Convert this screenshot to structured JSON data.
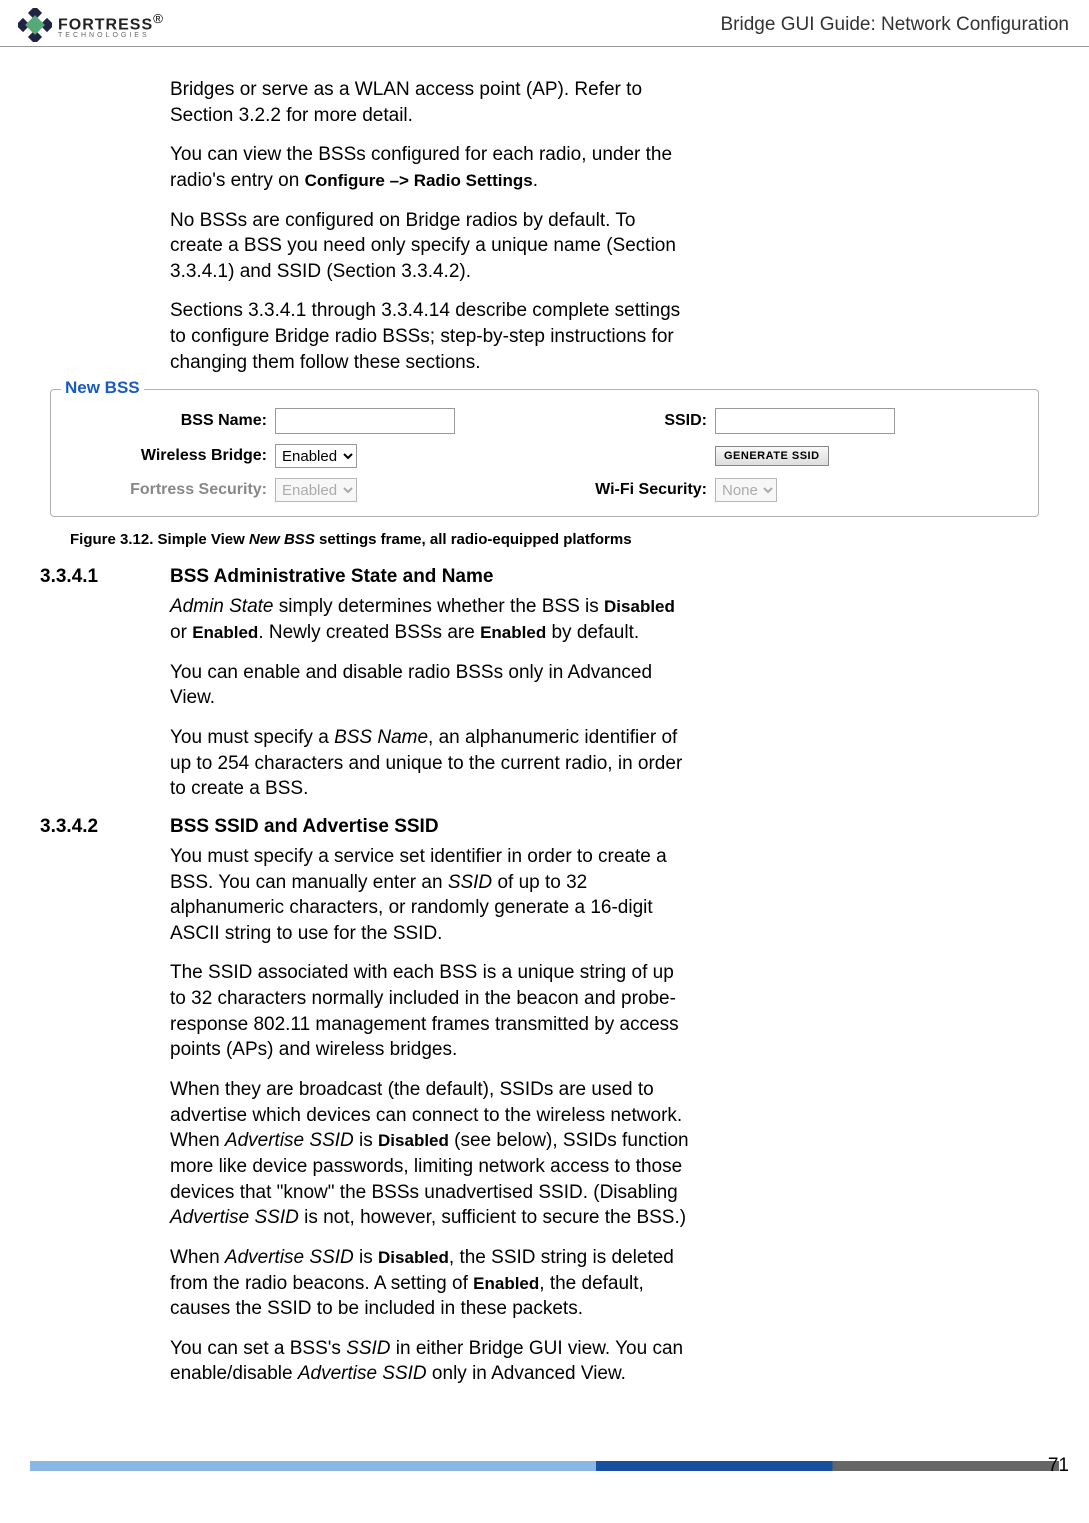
{
  "header": {
    "logo_main": "FORTRESS",
    "logo_reg": "®",
    "logo_sub": "TECHNOLOGIES",
    "title": "Bridge GUI Guide: Network Configuration"
  },
  "intro": {
    "p1": "Bridges or serve as a WLAN access point (AP). Refer to Section 3.2.2 for more detail.",
    "p2a": "You can view the BSSs configured for each radio, under the radio's entry on ",
    "p2b": "Configure  –> Radio Settings",
    "p2c": ".",
    "p3": "No BSSs are configured on Bridge radios by default. To create a BSS you need only specify a unique name (Section 3.3.4.1) and SSID (Section 3.3.4.2).",
    "p4": "Sections 3.3.4.1 through 3.3.4.14 describe complete settings to configure Bridge radio BSSs; step-by-step instructions for changing them follow these sections."
  },
  "form": {
    "legend": "New BSS",
    "labels": {
      "bss_name": "BSS Name:",
      "ssid": "SSID:",
      "wireless_bridge": "Wireless Bridge:",
      "fortress_security": "Fortress Security:",
      "wifi_security": "Wi-Fi Security:"
    },
    "values": {
      "wireless_bridge": "Enabled",
      "fortress_security": "Enabled",
      "wifi_security": "None"
    },
    "generate_btn": "GENERATE SSID"
  },
  "figure_caption": {
    "prefix": "Figure 3.12. Simple View ",
    "italic": "New BSS",
    "suffix": " settings frame, all radio-equipped platforms"
  },
  "sections": {
    "s1": {
      "num": "3.3.4.1",
      "title": "BSS Administrative State and Name",
      "p1a": "Admin State",
      "p1b": " simply determines whether the BSS is ",
      "p1c": "Disabled",
      "p1d": " or ",
      "p1e": "Enabled",
      "p1f": ". Newly created BSSs are ",
      "p1g": "Enabled",
      "p1h": " by default.",
      "p2": "You can enable and disable radio BSSs only in Advanced View.",
      "p3a": "You must specify a ",
      "p3b": "BSS Name",
      "p3c": ", an alphanumeric identifier of up to 254 characters and unique to the current radio, in order to create a BSS."
    },
    "s2": {
      "num": "3.3.4.2",
      "title": "BSS SSID and Advertise SSID",
      "p1a": "You must specify a service set identifier in order to create a BSS. You can manually enter an ",
      "p1b": "SSID",
      "p1c": " of up to 32 alphanumeric characters, or randomly generate a 16-digit ASCII string to use for the SSID.",
      "p2": "The SSID associated with each BSS is a unique string of up to 32 characters normally included in the beacon and probe-response 802.11 management frames transmitted by access points (APs) and wireless bridges.",
      "p3a": "When they are broadcast (the default), SSIDs are used to advertise which devices can connect to the wireless network. When ",
      "p3b": "Advertise SSID",
      "p3c": " is ",
      "p3d": "Disabled",
      "p3e": " (see below), SSIDs function more like device passwords, limiting network access to those devices that \"know\" the BSSs unadvertised SSID. (Disabling ",
      "p3f": "Advertise SSID",
      "p3g": " is not, however, sufficient to secure the BSS.)",
      "p4a": "When ",
      "p4b": "Advertise SSID",
      "p4c": " is ",
      "p4d": "Disabled",
      "p4e": ", the SSID string is deleted from the radio beacons. A setting of ",
      "p4f": "Enabled",
      "p4g": ", the default, causes the SSID to be included in these packets.",
      "p5a": "You can set a BSS's ",
      "p5b": "SSID",
      "p5c": " in either Bridge GUI view. You can enable/disable ",
      "p5d": "Advertise SSID",
      "p5e": " only in Advanced View."
    }
  },
  "page_number": "71"
}
